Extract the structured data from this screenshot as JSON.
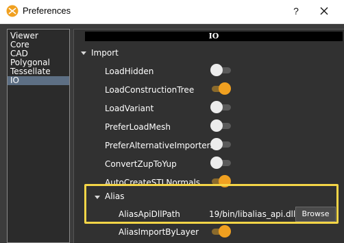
{
  "window": {
    "title": "Preferences",
    "help_label": "?"
  },
  "categories": [
    {
      "label": "Viewer",
      "selected": false
    },
    {
      "label": "Core",
      "selected": false
    },
    {
      "label": "CAD",
      "selected": false
    },
    {
      "label": "Polygonal",
      "selected": false
    },
    {
      "label": "Tessellate",
      "selected": false
    },
    {
      "label": "IO",
      "selected": true
    }
  ],
  "panel": {
    "header": "IO",
    "import_group": {
      "label": "Import",
      "expanded": true
    },
    "rows": [
      {
        "label": "LoadHidden",
        "on": false
      },
      {
        "label": "LoadConstructionTree",
        "on": true
      },
      {
        "label": "LoadVariant",
        "on": false
      },
      {
        "label": "PreferLoadMesh",
        "on": false
      },
      {
        "label": "PreferAlternativeImporters",
        "on": false
      },
      {
        "label": "ConvertZupToYup",
        "on": false
      },
      {
        "label": "AutoCreateSTLNormals",
        "on": true
      }
    ],
    "alias_group": {
      "label": "Alias",
      "expanded": true
    },
    "alias_path": {
      "label": "AliasApiDllPath",
      "value": "19/bin/libalias_api.dll",
      "button": "Browse"
    },
    "alias_import_by_layer": {
      "label": "AliasImportByLayer",
      "on": true
    }
  },
  "colors": {
    "accent": "#f0a020",
    "highlight": "#f5d547",
    "selected": "#5d6f84"
  }
}
